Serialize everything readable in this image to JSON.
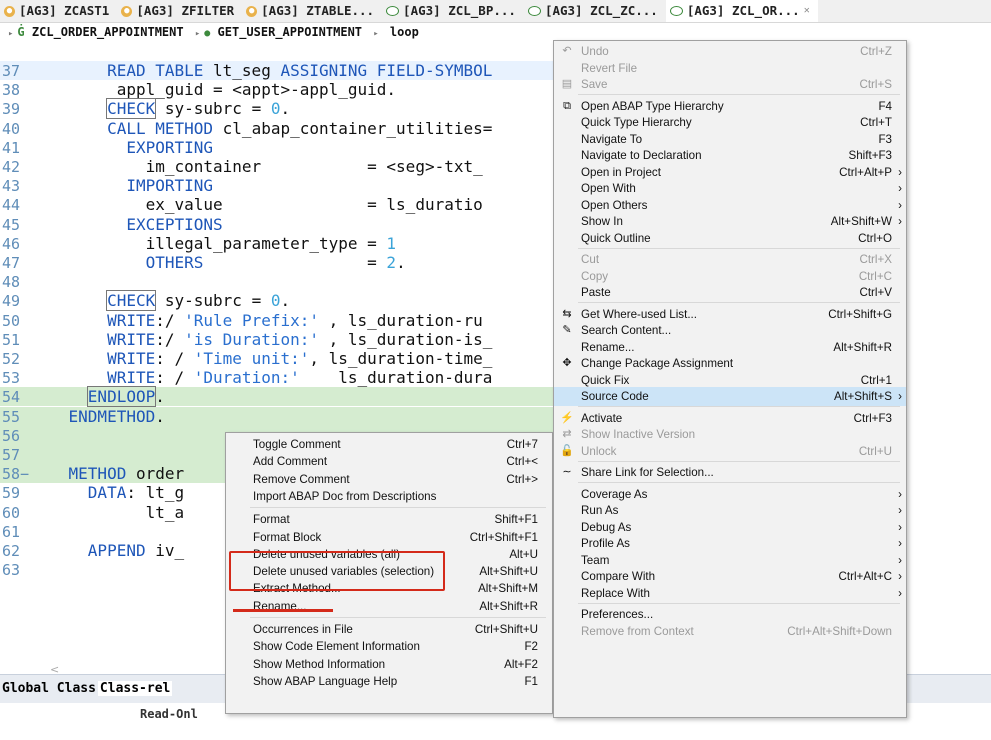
{
  "tabs": [
    {
      "label": "[AG3] ZCAST1",
      "type": "if",
      "close": ""
    },
    {
      "label": "[AG3] ZFILTER",
      "type": "if",
      "close": ""
    },
    {
      "label": "[AG3] ZTABLE...",
      "type": "if",
      "close": ""
    },
    {
      "label": "[AG3] ZCL_BP...",
      "type": "cl",
      "close": ""
    },
    {
      "label": "[AG3] ZCL_ZC...",
      "type": "cl",
      "close": ""
    },
    {
      "label": "[AG3] ZCL_OR...",
      "type": "cl",
      "close": "✕"
    }
  ],
  "breadcrumb": {
    "class_name": "ZCL_ORDER_APPOINTMENT",
    "method_name": "GET_USER_APPOINTMENT",
    "block": "loop"
  },
  "code_lines": [
    {
      "n": "37",
      "hl": "hl",
      "parts": [
        {
          "t": "        ",
          "c": "tx"
        },
        {
          "t": "READ TABLE",
          "c": "kw"
        },
        {
          "t": " lt_seg ",
          "c": "tx"
        },
        {
          "t": "ASSIGNING FIELD-SYMBOL",
          "c": "kw"
        }
      ]
    },
    {
      "n": "38",
      "hl": "",
      "parts": [
        {
          "t": "         appl_guid = <appt>-appl_guid.",
          "c": "tx"
        }
      ]
    },
    {
      "n": "39",
      "hl": "",
      "parts": [
        {
          "t": "        ",
          "c": "tx"
        },
        {
          "t": "CHECK",
          "c": "kw",
          "box": true
        },
        {
          "t": " sy-subrc = ",
          "c": "tx"
        },
        {
          "t": "0",
          "c": "num"
        },
        {
          "t": ".",
          "c": "tx"
        }
      ]
    },
    {
      "n": "40",
      "hl": "",
      "parts": [
        {
          "t": "        ",
          "c": "tx"
        },
        {
          "t": "CALL METHOD",
          "c": "kw"
        },
        {
          "t": " cl_abap_container_utilities=",
          "c": "tx"
        }
      ]
    },
    {
      "n": "41",
      "hl": "",
      "parts": [
        {
          "t": "          ",
          "c": "tx"
        },
        {
          "t": "EXPORTING",
          "c": "kw"
        }
      ]
    },
    {
      "n": "42",
      "hl": "",
      "parts": [
        {
          "t": "            im_container           = <seg>-txt_",
          "c": "tx"
        }
      ]
    },
    {
      "n": "43",
      "hl": "",
      "parts": [
        {
          "t": "          ",
          "c": "tx"
        },
        {
          "t": "IMPORTING",
          "c": "kw"
        }
      ]
    },
    {
      "n": "44",
      "hl": "",
      "parts": [
        {
          "t": "            ex_value               = ls_duratio",
          "c": "tx"
        }
      ]
    },
    {
      "n": "45",
      "hl": "",
      "parts": [
        {
          "t": "          ",
          "c": "tx"
        },
        {
          "t": "EXCEPTIONS",
          "c": "kw"
        }
      ]
    },
    {
      "n": "46",
      "hl": "",
      "parts": [
        {
          "t": "            illegal_parameter_type = ",
          "c": "tx"
        },
        {
          "t": "1",
          "c": "num"
        }
      ]
    },
    {
      "n": "47",
      "hl": "",
      "parts": [
        {
          "t": "            ",
          "c": "tx"
        },
        {
          "t": "OTHERS",
          "c": "kw"
        },
        {
          "t": "                 = ",
          "c": "tx"
        },
        {
          "t": "2",
          "c": "num"
        },
        {
          "t": ".",
          "c": "tx"
        }
      ]
    },
    {
      "n": "48",
      "hl": "",
      "parts": [
        {
          "t": "",
          "c": "tx"
        }
      ]
    },
    {
      "n": "49",
      "hl": "",
      "parts": [
        {
          "t": "        ",
          "c": "tx"
        },
        {
          "t": "CHECK",
          "c": "kw",
          "box": true
        },
        {
          "t": " sy-subrc = ",
          "c": "tx"
        },
        {
          "t": "0",
          "c": "num"
        },
        {
          "t": ".",
          "c": "tx"
        }
      ]
    },
    {
      "n": "50",
      "hl": "",
      "parts": [
        {
          "t": "        ",
          "c": "tx"
        },
        {
          "t": "WRITE",
          "c": "kw"
        },
        {
          "t": ":/ ",
          "c": "tx"
        },
        {
          "t": "'Rule Prefix:'",
          "c": "str"
        },
        {
          "t": " , ls_duration-ru",
          "c": "tx"
        }
      ]
    },
    {
      "n": "51",
      "hl": "",
      "parts": [
        {
          "t": "        ",
          "c": "tx"
        },
        {
          "t": "WRITE",
          "c": "kw"
        },
        {
          "t": ":/ ",
          "c": "tx"
        },
        {
          "t": "'is Duration:'",
          "c": "str"
        },
        {
          "t": " , ls_duration-is_",
          "c": "tx"
        }
      ]
    },
    {
      "n": "52",
      "hl": "",
      "parts": [
        {
          "t": "        ",
          "c": "tx"
        },
        {
          "t": "WRITE",
          "c": "kw"
        },
        {
          "t": ": / ",
          "c": "tx"
        },
        {
          "t": "'Time unit:'",
          "c": "str"
        },
        {
          "t": ", ls_duration-time_",
          "c": "tx"
        }
      ]
    },
    {
      "n": "53",
      "hl": "",
      "parts": [
        {
          "t": "        ",
          "c": "tx"
        },
        {
          "t": "WRITE",
          "c": "kw"
        },
        {
          "t": ": / ",
          "c": "tx"
        },
        {
          "t": "'Duration:'",
          "c": "str"
        },
        {
          "t": "    ls_duration-dura",
          "c": "tx"
        }
      ]
    },
    {
      "n": "54",
      "hl": "green",
      "parts": [
        {
          "t": "      ",
          "c": "tx"
        },
        {
          "t": "ENDLOOP",
          "c": "kw",
          "box": true
        },
        {
          "t": ".",
          "c": "tx"
        }
      ]
    },
    {
      "n": "55",
      "hl": "green",
      "parts": [
        {
          "t": "    ",
          "c": "tx"
        },
        {
          "t": "ENDMETHOD",
          "c": "kw"
        },
        {
          "t": ".",
          "c": "tx"
        }
      ]
    },
    {
      "n": "56",
      "hl": "green",
      "parts": [
        {
          "t": "",
          "c": "tx"
        }
      ]
    },
    {
      "n": "57",
      "hl": "green",
      "parts": [
        {
          "t": "",
          "c": "tx"
        }
      ]
    },
    {
      "n": "58−",
      "hl": "green",
      "parts": [
        {
          "t": "    ",
          "c": "tx"
        },
        {
          "t": "METHOD",
          "c": "kw"
        },
        {
          "t": " order",
          "c": "tx"
        }
      ]
    },
    {
      "n": "59",
      "hl": "",
      "parts": [
        {
          "t": "      ",
          "c": "tx"
        },
        {
          "t": "DATA",
          "c": "kw"
        },
        {
          "t": ": lt_g",
          "c": "tx"
        }
      ]
    },
    {
      "n": "60",
      "hl": "",
      "parts": [
        {
          "t": "            lt_a",
          "c": "tx"
        }
      ]
    },
    {
      "n": "61",
      "hl": "",
      "parts": [
        {
          "t": "",
          "c": "tx"
        }
      ]
    },
    {
      "n": "62",
      "hl": "",
      "parts": [
        {
          "t": "      ",
          "c": "tx"
        },
        {
          "t": "APPEND",
          "c": "kw"
        },
        {
          "t": " iv_",
          "c": "tx"
        }
      ]
    },
    {
      "n": "63",
      "hl": "",
      "parts": [
        {
          "t": "",
          "c": "tx"
        }
      ]
    }
  ],
  "hscroll_arrow": "<",
  "bottom_tabs": {
    "global": "Global Class",
    "class_rel": "Class-rel"
  },
  "bottom_strip_text": "Read-Onl",
  "left_menu": [
    {
      "label": "Toggle Comment",
      "shortcut": "Ctrl+7"
    },
    {
      "label": "Add Comment",
      "shortcut": "Ctrl+<"
    },
    {
      "label": "Remove Comment",
      "shortcut": "Ctrl+>"
    },
    {
      "label": "Import ABAP Doc from Descriptions",
      "shortcut": ""
    },
    {
      "sep": true
    },
    {
      "label": "Format",
      "shortcut": "Shift+F1"
    },
    {
      "label": "Format Block",
      "shortcut": "Ctrl+Shift+F1"
    },
    {
      "label": "Delete unused variables (all)",
      "shortcut": "Alt+U"
    },
    {
      "label": "Delete unused variables (selection)",
      "shortcut": "Alt+Shift+U"
    },
    {
      "label": "Extract Method...",
      "shortcut": "Alt+Shift+M"
    },
    {
      "label": "Rename...",
      "shortcut": "Alt+Shift+R"
    },
    {
      "sep": true
    },
    {
      "label": "Occurrences in File",
      "shortcut": "Ctrl+Shift+U"
    },
    {
      "label": "Show Code Element Information",
      "shortcut": "F2"
    },
    {
      "label": "Show Method Information",
      "shortcut": "Alt+F2"
    },
    {
      "label": "Show ABAP Language Help",
      "shortcut": "F1"
    }
  ],
  "right_menu": [
    {
      "label": "Undo",
      "shortcut": "Ctrl+Z",
      "dis": true,
      "icon": "undo-icon",
      "glyph": "↶"
    },
    {
      "label": "Revert File",
      "shortcut": "",
      "dis": true
    },
    {
      "label": "Save",
      "shortcut": "Ctrl+S",
      "dis": true,
      "icon": "save-icon",
      "glyph": "▤"
    },
    {
      "sep": true
    },
    {
      "label": "Open ABAP Type Hierarchy",
      "shortcut": "F4",
      "icon": "type-hierarchy-icon",
      "glyph": "⧉"
    },
    {
      "label": "Quick Type Hierarchy",
      "shortcut": "Ctrl+T"
    },
    {
      "label": "Navigate To",
      "shortcut": "F3"
    },
    {
      "label": "Navigate to Declaration",
      "shortcut": "Shift+F3"
    },
    {
      "label": "Open in Project",
      "shortcut": "Ctrl+Alt+P",
      "sub": true
    },
    {
      "label": "Open With",
      "shortcut": "",
      "sub": true
    },
    {
      "label": "Open Others",
      "shortcut": "",
      "sub": true
    },
    {
      "label": "Show In",
      "shortcut": "Alt+Shift+W",
      "sub": true
    },
    {
      "label": "Quick Outline",
      "shortcut": "Ctrl+O"
    },
    {
      "sep": true
    },
    {
      "label": "Cut",
      "shortcut": "Ctrl+X",
      "dis": true
    },
    {
      "label": "Copy",
      "shortcut": "Ctrl+C",
      "dis": true
    },
    {
      "label": "Paste",
      "shortcut": "Ctrl+V"
    },
    {
      "sep": true
    },
    {
      "label": "Get Where-used List...",
      "shortcut": "Ctrl+Shift+G",
      "icon": "where-used-icon",
      "glyph": "⇆"
    },
    {
      "label": "Search Content...",
      "shortcut": "",
      "icon": "search-content-icon",
      "glyph": "✎"
    },
    {
      "label": "Rename...",
      "shortcut": "Alt+Shift+R"
    },
    {
      "label": "Change Package Assignment",
      "shortcut": "",
      "icon": "package-icon",
      "glyph": "✥"
    },
    {
      "label": "Quick Fix",
      "shortcut": "Ctrl+1"
    },
    {
      "label": "Source Code",
      "shortcut": "Alt+Shift+S",
      "sub": true,
      "hover": true
    },
    {
      "sep": true
    },
    {
      "label": "Activate",
      "shortcut": "Ctrl+F3",
      "icon": "activate-icon",
      "glyph": "⚡"
    },
    {
      "label": "Show Inactive Version",
      "shortcut": "",
      "dis": true,
      "icon": "inactive-version-icon",
      "glyph": "⇄"
    },
    {
      "label": "Unlock",
      "shortcut": "Ctrl+U",
      "dis": true,
      "icon": "unlock-icon",
      "glyph": "🔓"
    },
    {
      "sep": true
    },
    {
      "label": "Share Link for Selection...",
      "shortcut": "",
      "icon": "share-link-icon",
      "glyph": "∼"
    },
    {
      "sep": true
    },
    {
      "label": "Coverage As",
      "shortcut": "",
      "sub": true
    },
    {
      "label": "Run As",
      "shortcut": "",
      "sub": true
    },
    {
      "label": "Debug As",
      "shortcut": "",
      "sub": true
    },
    {
      "label": "Profile As",
      "shortcut": "",
      "sub": true
    },
    {
      "label": "Team",
      "shortcut": "",
      "sub": true
    },
    {
      "label": "Compare With",
      "shortcut": "Ctrl+Alt+C",
      "sub": true
    },
    {
      "label": "Replace With",
      "shortcut": "",
      "sub": true
    },
    {
      "sep": true
    },
    {
      "label": "Preferences...",
      "shortcut": ""
    },
    {
      "label": "Remove from Context",
      "shortcut": "Ctrl+Alt+Shift+Down",
      "dis": true
    }
  ]
}
